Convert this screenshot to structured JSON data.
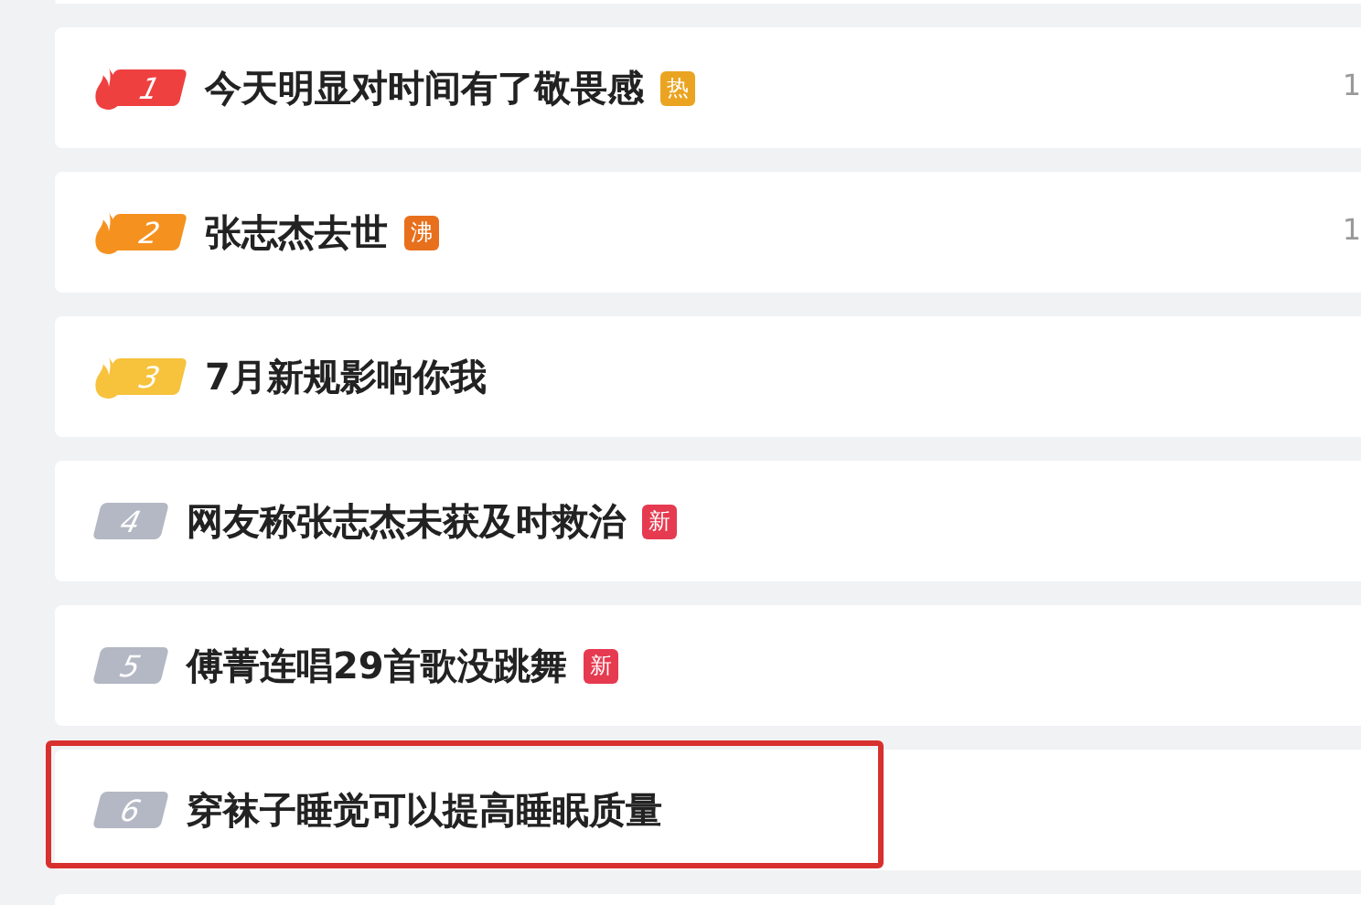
{
  "rows": [
    {
      "rank": "1",
      "kind": "top",
      "color": "#ef4040",
      "title": "今天明显对时间有了敬畏感",
      "tag": {
        "text": "热",
        "color": "#eba422"
      },
      "count": "1",
      "highlighted": false
    },
    {
      "rank": "2",
      "kind": "top",
      "color": "#f5921f",
      "title": "张志杰去世",
      "tag": {
        "text": "沸",
        "color": "#e8701d"
      },
      "count": "1",
      "highlighted": false
    },
    {
      "rank": "3",
      "kind": "top",
      "color": "#f7c23c",
      "title": "7月新规影响你我",
      "highlighted": false
    },
    {
      "rank": "4",
      "kind": "plain",
      "color": "#b4b8c4",
      "title": "网友称张志杰未获及时救治",
      "tag": {
        "text": "新",
        "color": "#e63a50"
      },
      "highlighted": false
    },
    {
      "rank": "5",
      "kind": "plain",
      "color": "#b4b8c4",
      "title": "傅菁连唱29首歌没跳舞",
      "tag": {
        "text": "新",
        "color": "#e63a50"
      },
      "highlighted": false
    },
    {
      "rank": "6",
      "kind": "plain",
      "color": "#b4b8c4",
      "title": "穿袜子睡觉可以提高睡眠质量",
      "highlighted": true
    }
  ]
}
